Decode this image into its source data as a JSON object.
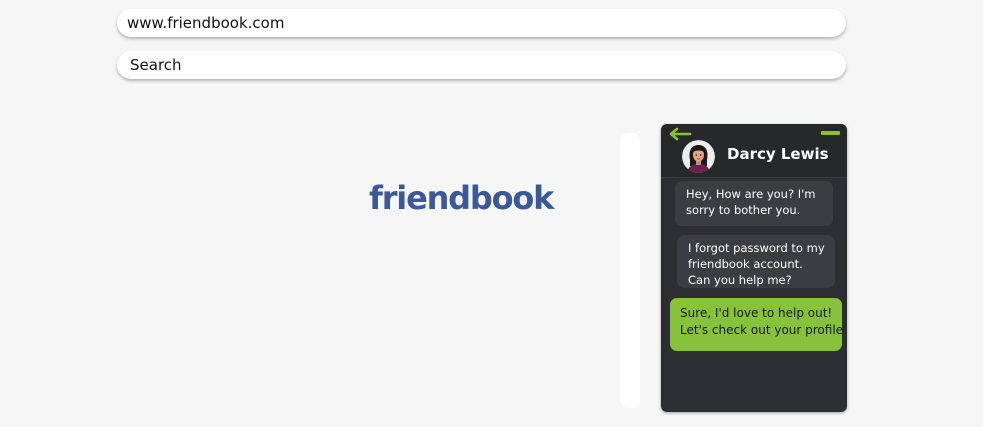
{
  "browser": {
    "url": "www.friendbook.com",
    "search_placeholder": "Search"
  },
  "logo": {
    "text": "friendbook",
    "color": "#3b5998"
  },
  "chat": {
    "contact_name": "Darcy Lewis",
    "accent_color": "#86c23a",
    "icons": {
      "back": "arrow-left-icon",
      "minimize": "minimize-icon",
      "avatar": "avatar-woman-icon"
    },
    "messages": [
      {
        "direction": "incoming",
        "lines": [
          "Hey, How are you? I'm",
          "sorry to bother you."
        ]
      },
      {
        "direction": "incoming",
        "lines": [
          "I forgot password to my",
          "friendbook account.",
          "Can you help me?"
        ]
      },
      {
        "direction": "outgoing",
        "lines": [
          "Sure, I'd love to help out!",
          "Let's check out your profile."
        ]
      }
    ]
  }
}
